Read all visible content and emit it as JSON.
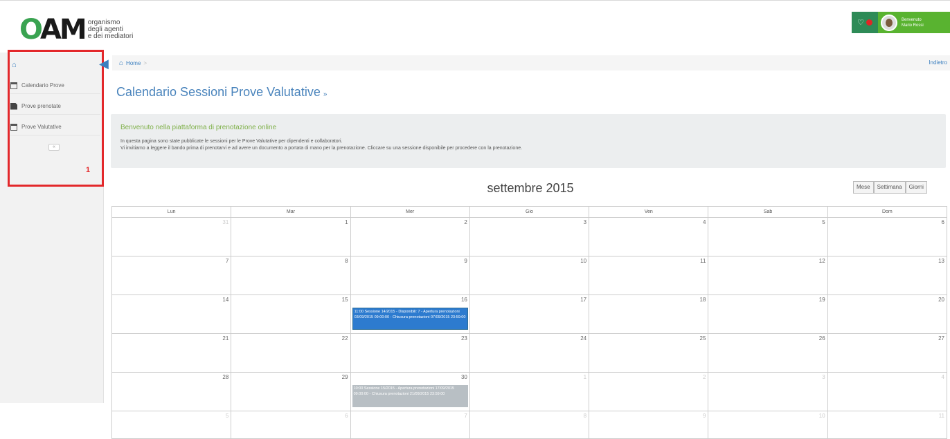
{
  "header": {
    "logo_mark": "OAM",
    "logo_lines": [
      "organismo",
      "degli agenti",
      "e dei mediatori"
    ],
    "user_lines": [
      "Benvenuto",
      "Mario Rossi"
    ],
    "colors": {
      "notif_bg": "#2e8b57",
      "user_bg": "#59b330",
      "badge": "#e02626"
    }
  },
  "sidebar": {
    "home_icon": "home-icon",
    "items": [
      {
        "label": "Calendario Prove",
        "icon": "calendar-icon"
      },
      {
        "label": "Prove prenotate",
        "icon": "document-icon"
      },
      {
        "label": "Prove Valutative",
        "icon": "calendar-icon"
      }
    ],
    "more_label": "«",
    "annotation": "1"
  },
  "breadcrumb": {
    "home": "Home",
    "sep": ">",
    "right_link": "Indietro"
  },
  "page": {
    "title": "Calendario Sessioni Prove Valutative",
    "title_caret": "»"
  },
  "welcome": {
    "title": "Benvenuto nella piattaforma di prenotazione online",
    "line1": "In questa pagina sono state pubblicate le sessioni per le Prove Valutative per dipendenti e collaboratori.",
    "line2": "Vi invitiamo a leggere il bando prima di prenotarvi e ad avere un documento a portata di mano per la prenotazione. Cliccare su una sessione disponibile per procedere con la prenotazione."
  },
  "calendar": {
    "month": "settembre 2015",
    "views": [
      "Mese",
      "Settimana",
      "Giorni"
    ],
    "weekdays": [
      "Lun",
      "Mar",
      "Mer",
      "Gio",
      "Ven",
      "Sab",
      "Dom"
    ],
    "weeks": [
      [
        "31",
        "1",
        "2",
        "3",
        "4",
        "5",
        "6"
      ],
      [
        "7",
        "8",
        "9",
        "10",
        "11",
        "12",
        "13"
      ],
      [
        "14",
        "15",
        "16",
        "17",
        "18",
        "19",
        "20"
      ],
      [
        "21",
        "22",
        "23",
        "24",
        "25",
        "26",
        "27"
      ],
      [
        "28",
        "29",
        "30",
        "1",
        "2",
        "3",
        "4"
      ],
      [
        "5",
        "6",
        "7",
        "8",
        "9",
        "10",
        "11"
      ]
    ],
    "events": {
      "sep16": "11:00 Sessione 14/2015 - Disponibili: 7 - Apertura prenotazioni 03/09/2015 09:00:00 - Chiusura prenotazioni 07/09/2015 23:59:00",
      "sep30": "10:00 Sessione 15/2015 - Apertura prenotazioni 17/09/2015 09:00:00 - Chiusura prenotazioni 21/09/2015 23:59:00"
    }
  }
}
